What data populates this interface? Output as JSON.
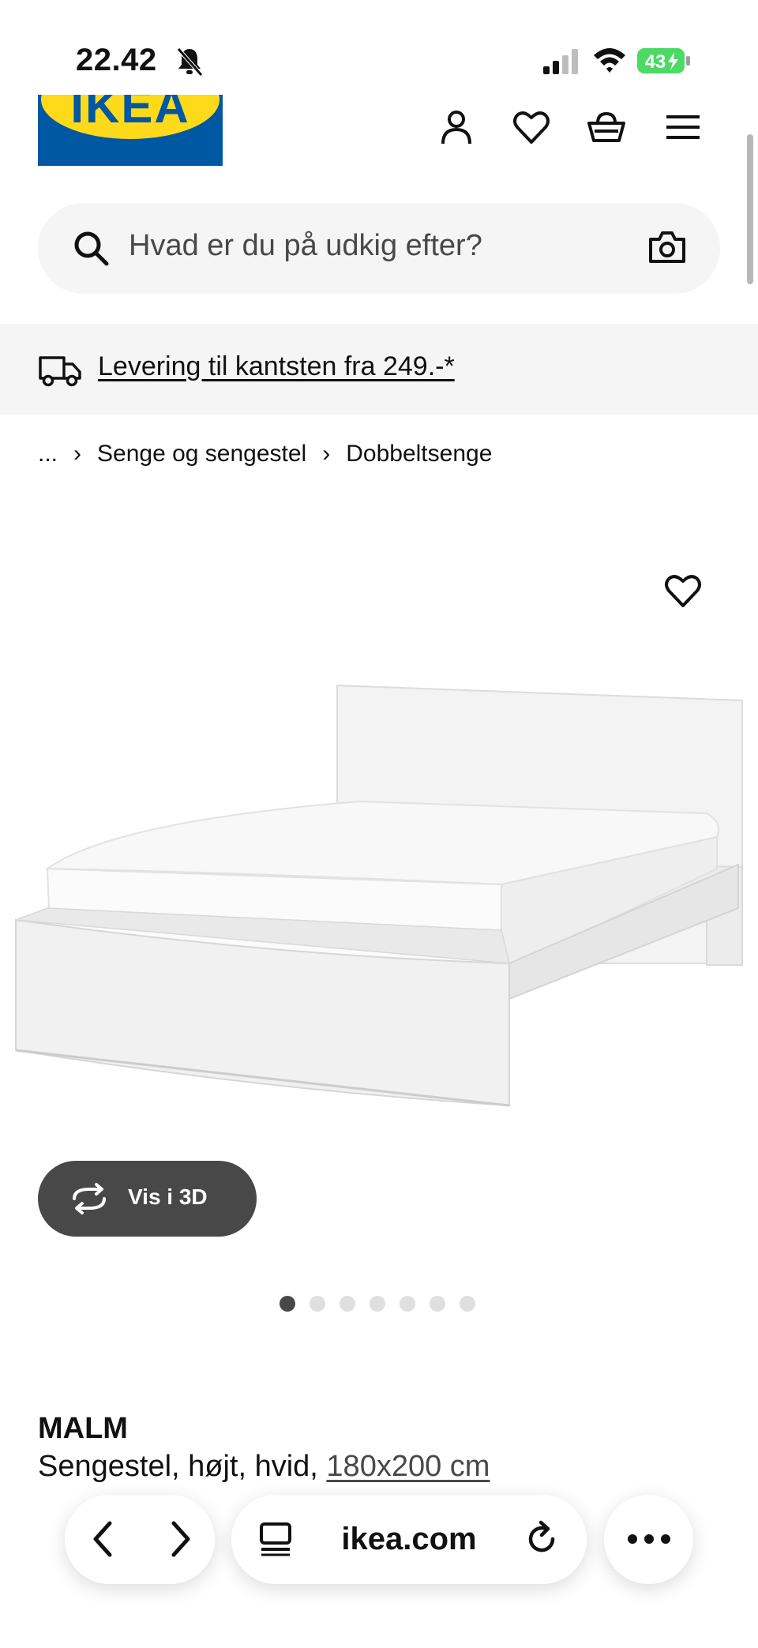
{
  "status_bar": {
    "time": "22.42",
    "battery": "43"
  },
  "header": {
    "logo_text": "IKEA",
    "icons": [
      "profile-icon",
      "heart-icon",
      "basket-icon",
      "menu-icon"
    ]
  },
  "search": {
    "placeholder": "Hvad er du på udkig efter?"
  },
  "banner": {
    "text": "Levering til kantsten fra 249.-*"
  },
  "breadcrumb": {
    "items": [
      "...",
      "Senge og sengestel",
      "Dobbeltsenge"
    ]
  },
  "gallery": {
    "view_3d_label": "Vis i 3D",
    "slide_count": 7,
    "active_index": 0
  },
  "product": {
    "name": "MALM",
    "description": "Sengestel, højt, hvid,",
    "size": "180x200 cm"
  },
  "browser": {
    "url": "ikea.com"
  },
  "colors": {
    "ikea_blue": "#0058a3",
    "ikea_yellow": "#ffda1a",
    "dark_button": "#484848",
    "battery_green": "#4cd964"
  }
}
